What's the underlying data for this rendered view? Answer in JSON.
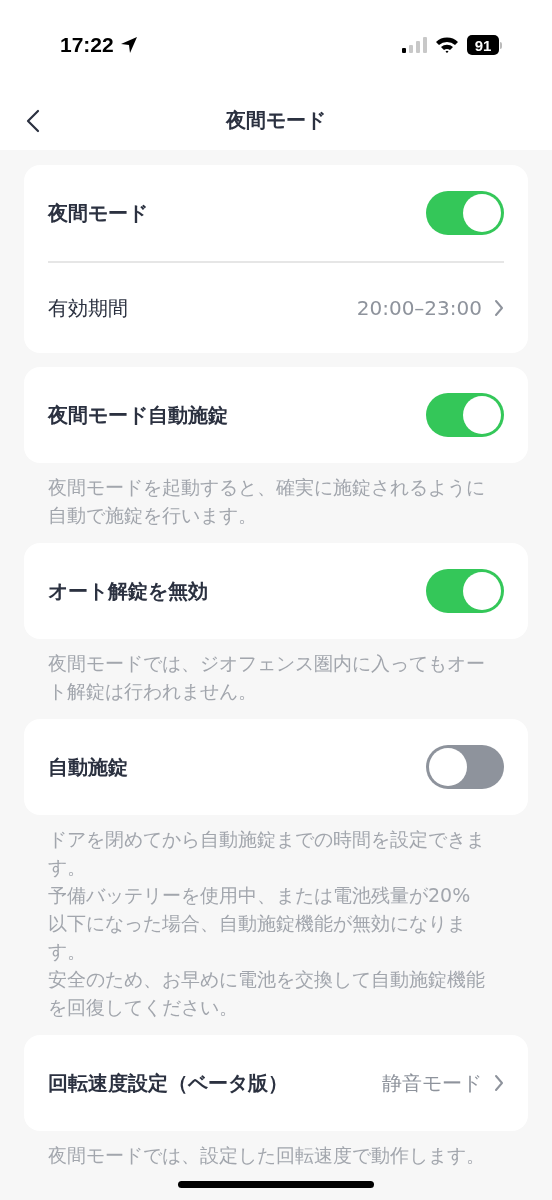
{
  "status_bar": {
    "time": "17:22",
    "battery": "91"
  },
  "nav": {
    "title": "夜間モード"
  },
  "sections": [
    {
      "rows": [
        {
          "kind": "toggle",
          "label": "夜間モード",
          "on": true
        },
        {
          "kind": "link",
          "label": "有効期間",
          "value": "20:00–23:00"
        }
      ]
    },
    {
      "rows": [
        {
          "kind": "toggle",
          "label": "夜間モード自動施錠",
          "on": true
        }
      ],
      "notes": [
        "夜間モードを起動すると、確実に施錠されるように自動で施錠を行います。"
      ]
    },
    {
      "rows": [
        {
          "kind": "toggle",
          "label": "オート解錠を無効",
          "on": true
        }
      ],
      "notes": [
        "夜間モードでは、ジオフェンス圏内に入ってもオート解錠は行われません。"
      ]
    },
    {
      "rows": [
        {
          "kind": "toggle",
          "label": "自動施錠",
          "on": false
        }
      ],
      "notes": [
        "ドアを閉めてから自動施錠までの時間を設定できます。",
        "予備バッテリーを使用中、または電池残量が20%以下になった場合、自動施錠機能が無効になります。",
        "安全のため、お早めに電池を交換して自動施錠機能を回復してください。"
      ]
    },
    {
      "rows": [
        {
          "kind": "link",
          "label": "回転速度設定（ベータ版）",
          "value": "静音モード"
        }
      ],
      "notes": [
        "夜間モードでは、設定した回転速度で動作します。"
      ]
    }
  ]
}
